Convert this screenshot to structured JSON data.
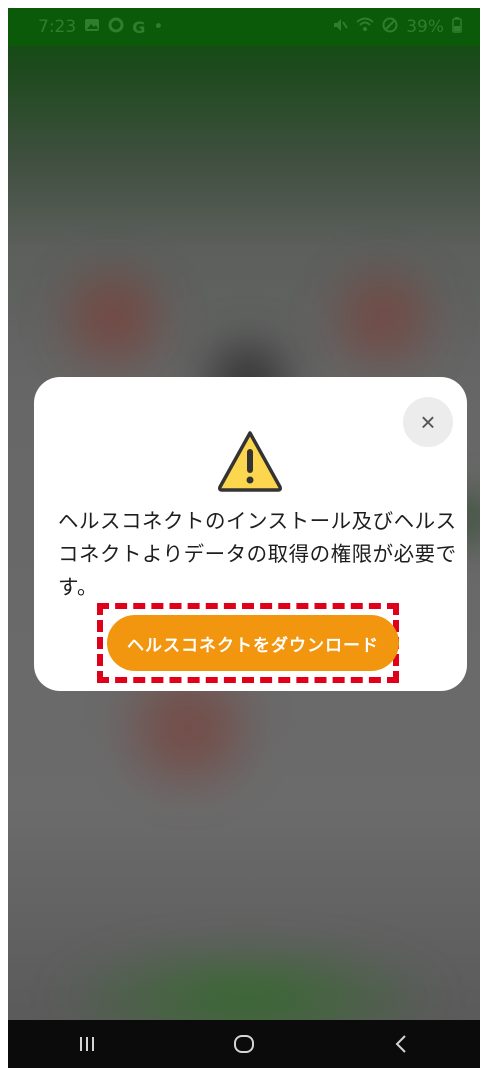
{
  "status_bar": {
    "time": "7:23",
    "left_icons": [
      "gallery-icon",
      "sync-icon",
      "google-icon",
      "dot-icon"
    ],
    "google_glyph": "G",
    "dot_glyph": "•",
    "battery": "39%"
  },
  "dialog": {
    "message": "ヘルスコネクトのインストール及びヘルスコネクトよりデータの取得の権限が必要です。",
    "download_label": "ヘルスコネクトをダウンロード",
    "close_glyph": "×",
    "accent_color": "#f2950f",
    "warning_color": "#fcd64f",
    "highlight_color": "#e0001a"
  },
  "nav_bar": {
    "recent_label": "recent-apps",
    "home_label": "home",
    "back_label": "back"
  }
}
